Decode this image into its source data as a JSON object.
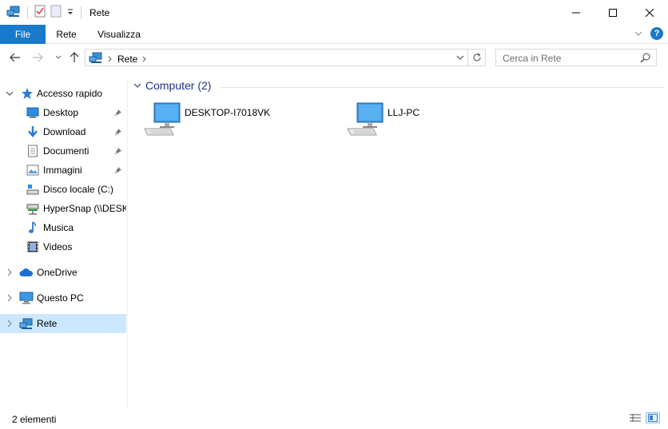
{
  "window": {
    "title": "Rete"
  },
  "ribbon": {
    "tabs": [
      {
        "label": "File"
      },
      {
        "label": "Rete"
      },
      {
        "label": "Visualizza"
      }
    ],
    "help": "?"
  },
  "address": {
    "path": "Rete"
  },
  "search": {
    "placeholder": "Cerca in Rete"
  },
  "nav": {
    "quick_access": "Accesso rapido",
    "items": [
      {
        "label": "Desktop"
      },
      {
        "label": "Download"
      },
      {
        "label": "Documenti"
      },
      {
        "label": "Immagini"
      },
      {
        "label": "Disco locale (C:)"
      },
      {
        "label": "HyperSnap (\\\\DESK"
      },
      {
        "label": "Musica"
      },
      {
        "label": "Videos"
      }
    ],
    "onedrive": "OneDrive",
    "this_pc": "Questo PC",
    "network": "Rete"
  },
  "content": {
    "group": "Computer (2)",
    "computers": [
      {
        "name": "DESKTOP-I7018VK"
      },
      {
        "name": "LLJ-PC"
      }
    ]
  },
  "status": {
    "count": "2 elementi"
  },
  "colors": {
    "accent": "#1979ca",
    "selected": "#cce8ff",
    "group_title": "#1e3287"
  }
}
